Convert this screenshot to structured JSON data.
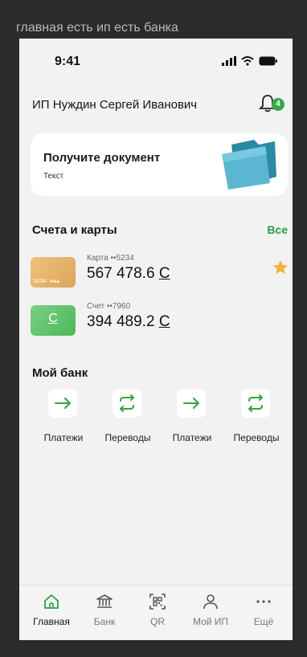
{
  "frame": {
    "title": "главная есть ип есть банка"
  },
  "status": {
    "time": "9:41"
  },
  "header": {
    "user": "ИП Нуждин Сергей Иванович",
    "notifications": "4"
  },
  "promo": {
    "title": "Получите документ",
    "subtitle": "Текст"
  },
  "accounts": {
    "title": "Счета и карты",
    "all": "Все",
    "items": [
      {
        "label": "Карта ••5234",
        "amount": "567 478.6 ",
        "currency": "С",
        "thumb_text": "5234",
        "thumb_brand": "visa",
        "favorite": true
      },
      {
        "label": "Счет ••7960",
        "amount": "394 489.2 ",
        "currency": "С",
        "thumb_text": "С",
        "favorite": false
      }
    ]
  },
  "mybank": {
    "title": "Мой банк",
    "items": [
      {
        "label": "Платежи",
        "icon": "arrow-right-icon"
      },
      {
        "label": "Переводы",
        "icon": "exchange-icon"
      },
      {
        "label": "Платежи",
        "icon": "arrow-right-icon"
      },
      {
        "label": "Переводы",
        "icon": "exchange-icon"
      }
    ]
  },
  "tabbar": {
    "items": [
      {
        "label": "Главная",
        "icon": "home-icon",
        "active": true
      },
      {
        "label": "Банк",
        "icon": "bank-icon",
        "active": false
      },
      {
        "label": "QR",
        "icon": "qr-icon",
        "active": false
      },
      {
        "label": "Мой ИП",
        "icon": "user-icon",
        "active": false
      },
      {
        "label": "Ещё",
        "icon": "more-icon",
        "active": false
      }
    ]
  },
  "colors": {
    "accent": "#2e9b3f",
    "card_gold": "#e5b36a",
    "account_green": "#5cc66b"
  }
}
